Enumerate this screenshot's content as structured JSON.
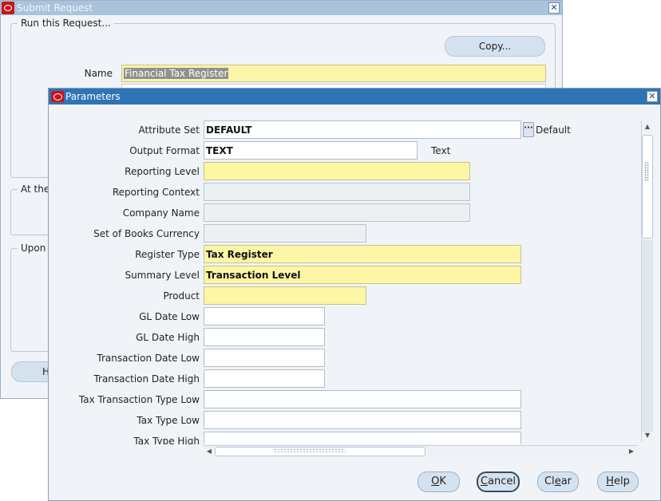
{
  "background_window": {
    "title": "Submit Request",
    "group_run_label": "Run this Request...",
    "copy_label": "Copy...",
    "name_label": "Name",
    "name_value": "Financial Tax Register",
    "group_at_label": "At the",
    "group_upon_label": "Upon",
    "help_label": "H"
  },
  "dialog": {
    "title": "Parameters",
    "fields": [
      {
        "label": "Attribute Set",
        "value": "DEFAULT",
        "after": "Default"
      },
      {
        "label": "Output Format",
        "value": "TEXT",
        "after": "Text"
      },
      {
        "label": "Reporting Level",
        "value": ""
      },
      {
        "label": "Reporting Context",
        "value": ""
      },
      {
        "label": "Company Name",
        "value": ""
      },
      {
        "label": "Set of Books Currency",
        "value": ""
      },
      {
        "label": "Register Type",
        "value": "Tax Register"
      },
      {
        "label": "Summary Level",
        "value": "Transaction Level"
      },
      {
        "label": "Product",
        "value": ""
      },
      {
        "label": "GL Date Low",
        "value": ""
      },
      {
        "label": "GL Date High",
        "value": ""
      },
      {
        "label": "Transaction Date Low",
        "value": ""
      },
      {
        "label": "Transaction Date High",
        "value": ""
      },
      {
        "label": "Tax Transaction Type Low",
        "value": ""
      },
      {
        "label": "Tax Type Low",
        "value": ""
      },
      {
        "label": "Tax Type High",
        "value": ""
      }
    ],
    "buttons": {
      "ok": {
        "pre": "",
        "mnemonic": "O",
        "post": "K"
      },
      "cancel": {
        "pre": "",
        "mnemonic": "C",
        "post": "ancel"
      },
      "clear": {
        "pre": "Cl",
        "mnemonic": "e",
        "post": "ar"
      },
      "help": {
        "pre": "",
        "mnemonic": "H",
        "post": "elp"
      }
    }
  },
  "colors": {
    "required_field": "#fcf6a6",
    "title_active": "#2f74b5",
    "title_inactive": "#a9c3dc",
    "button_fill": "#d4e2f0"
  },
  "icons": [
    "oracle-logo-icon",
    "close-icon",
    "lov-ellipsis-icon",
    "scroll-up-icon",
    "scroll-down-icon",
    "scroll-left-icon",
    "scroll-right-icon"
  ]
}
